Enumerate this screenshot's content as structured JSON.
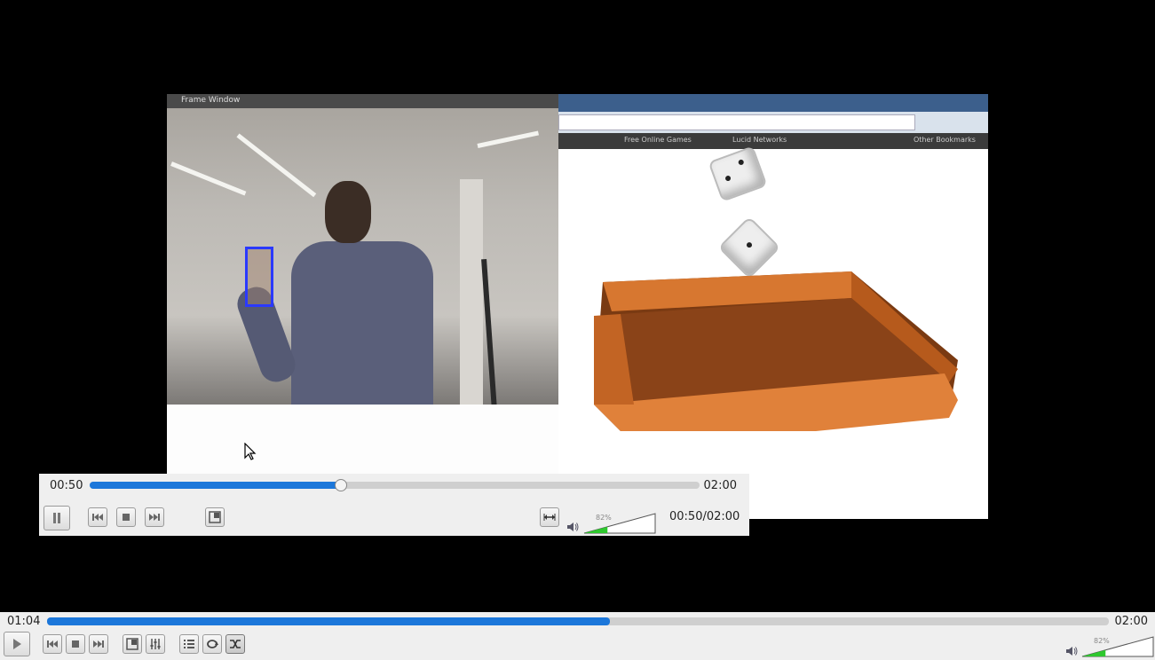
{
  "video_frame": {
    "webcam_title": "Frame Window",
    "bookmarks": [
      "Free Online Games",
      "Lucid Networks",
      "Other Bookmarks"
    ]
  },
  "fullscreen_controller": {
    "current_time": "00:50",
    "total_time": "02:00",
    "seek_progress": 0.41,
    "time_readout": "00:50/02:00",
    "volume_label": "82%",
    "volume_level": 0.82,
    "buttons": {
      "pause": "pause-icon",
      "previous": "previous-icon",
      "stop": "stop-icon",
      "next": "next-icon",
      "fullscreen": "fullscreen-icon",
      "aspect": "stretch-icon",
      "mute": "speaker-icon"
    }
  },
  "main_controller": {
    "current_time": "01:04",
    "total_time": "02:00",
    "seek_progress": 0.53,
    "volume_label": "82%",
    "volume_level": 0.82
  },
  "colors": {
    "accent": "#1c77da",
    "volume_green": "#2ec82e",
    "background": "#000000",
    "controller_bg": "#efefef"
  }
}
